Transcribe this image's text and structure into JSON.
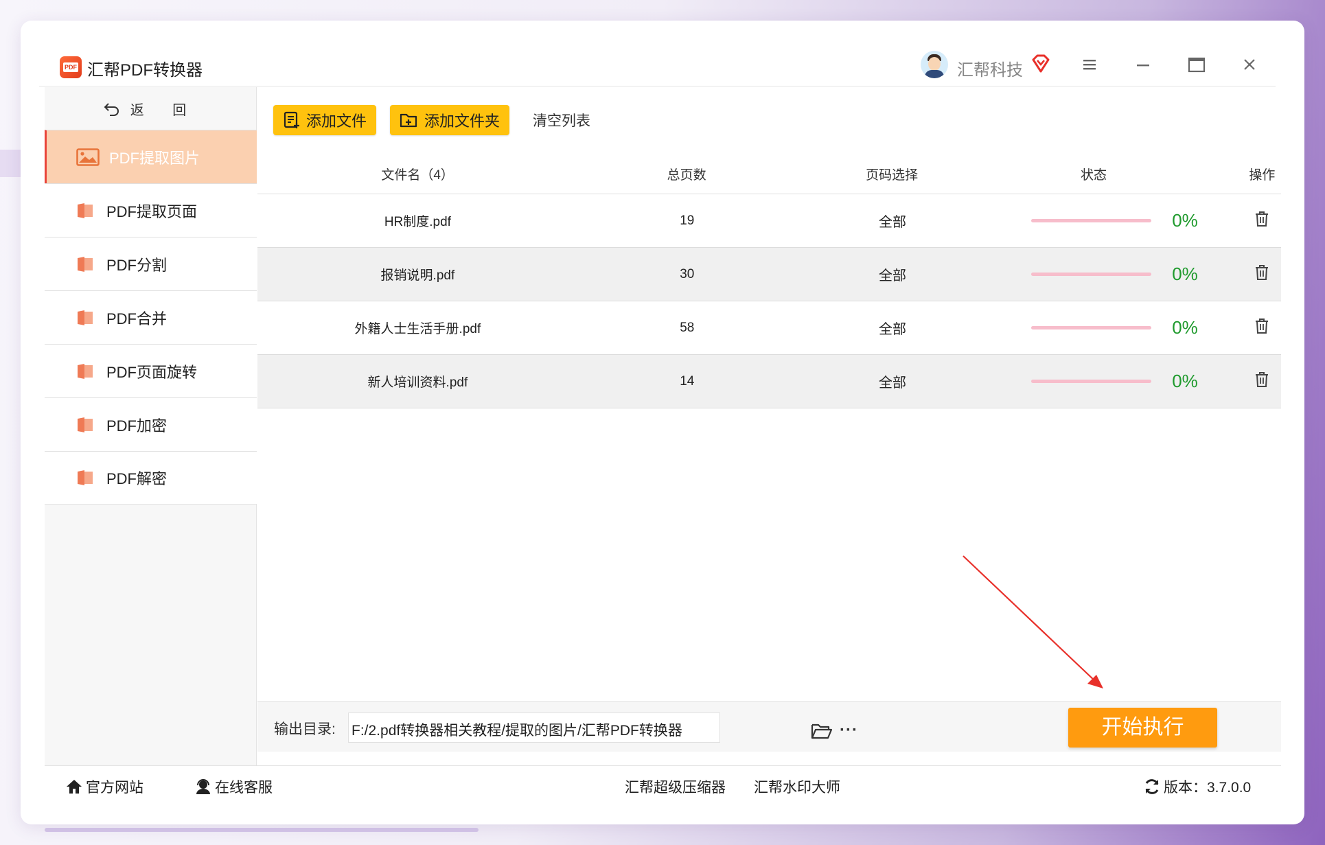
{
  "app": {
    "title": "汇帮PDF转换器",
    "user_name": "汇帮科技",
    "colors": {
      "accent": "#ff9b0f",
      "toolbar_button": "#ffc20e",
      "active_nav": "#fbd0b0",
      "progress": "#f7bdcb",
      "percent": "#1f9a2d",
      "annotation_arrow": "#e8302a"
    }
  },
  "sidebar": {
    "back_label": "返 回",
    "items": [
      {
        "label": "PDF提取图片",
        "icon": "image-icon",
        "active": true
      },
      {
        "label": "PDF提取页面",
        "icon": "pdf-file-icon"
      },
      {
        "label": "PDF分割",
        "icon": "pdf-file-icon"
      },
      {
        "label": "PDF合并",
        "icon": "pdf-file-icon"
      },
      {
        "label": "PDF页面旋转",
        "icon": "pdf-file-icon"
      },
      {
        "label": "PDF加密",
        "icon": "pdf-file-icon"
      },
      {
        "label": "PDF解密",
        "icon": "pdf-file-icon"
      }
    ]
  },
  "toolbar": {
    "add_file": "添加文件",
    "add_folder": "添加文件夹",
    "clear_list": "清空列表"
  },
  "table": {
    "headers": {
      "name": "文件名（4）",
      "pages": "总页数",
      "range": "页码选择",
      "status": "状态",
      "op": "操作"
    },
    "rows": [
      {
        "name": "HR制度.pdf",
        "pages": "19",
        "range": "全部",
        "progress": 0,
        "percent": "0%"
      },
      {
        "name": "报销说明.pdf",
        "pages": "30",
        "range": "全部",
        "progress": 0,
        "percent": "0%"
      },
      {
        "name": "外籍人士生活手册.pdf",
        "pages": "58",
        "range": "全部",
        "progress": 0,
        "percent": "0%"
      },
      {
        "name": "新人培训资料.pdf",
        "pages": "14",
        "range": "全部",
        "progress": 0,
        "percent": "0%"
      }
    ]
  },
  "output": {
    "label": "输出目录:",
    "path": "F:/2.pdf转换器相关教程/提取的图片/汇帮PDF转换器",
    "more": "···"
  },
  "start_button": "开始执行",
  "statusbar": {
    "website": "官方网站",
    "support": "在线客服",
    "compressor": "汇帮超级压缩器",
    "watermark": "汇帮水印大师",
    "version": "版本：3.7.0.0"
  }
}
